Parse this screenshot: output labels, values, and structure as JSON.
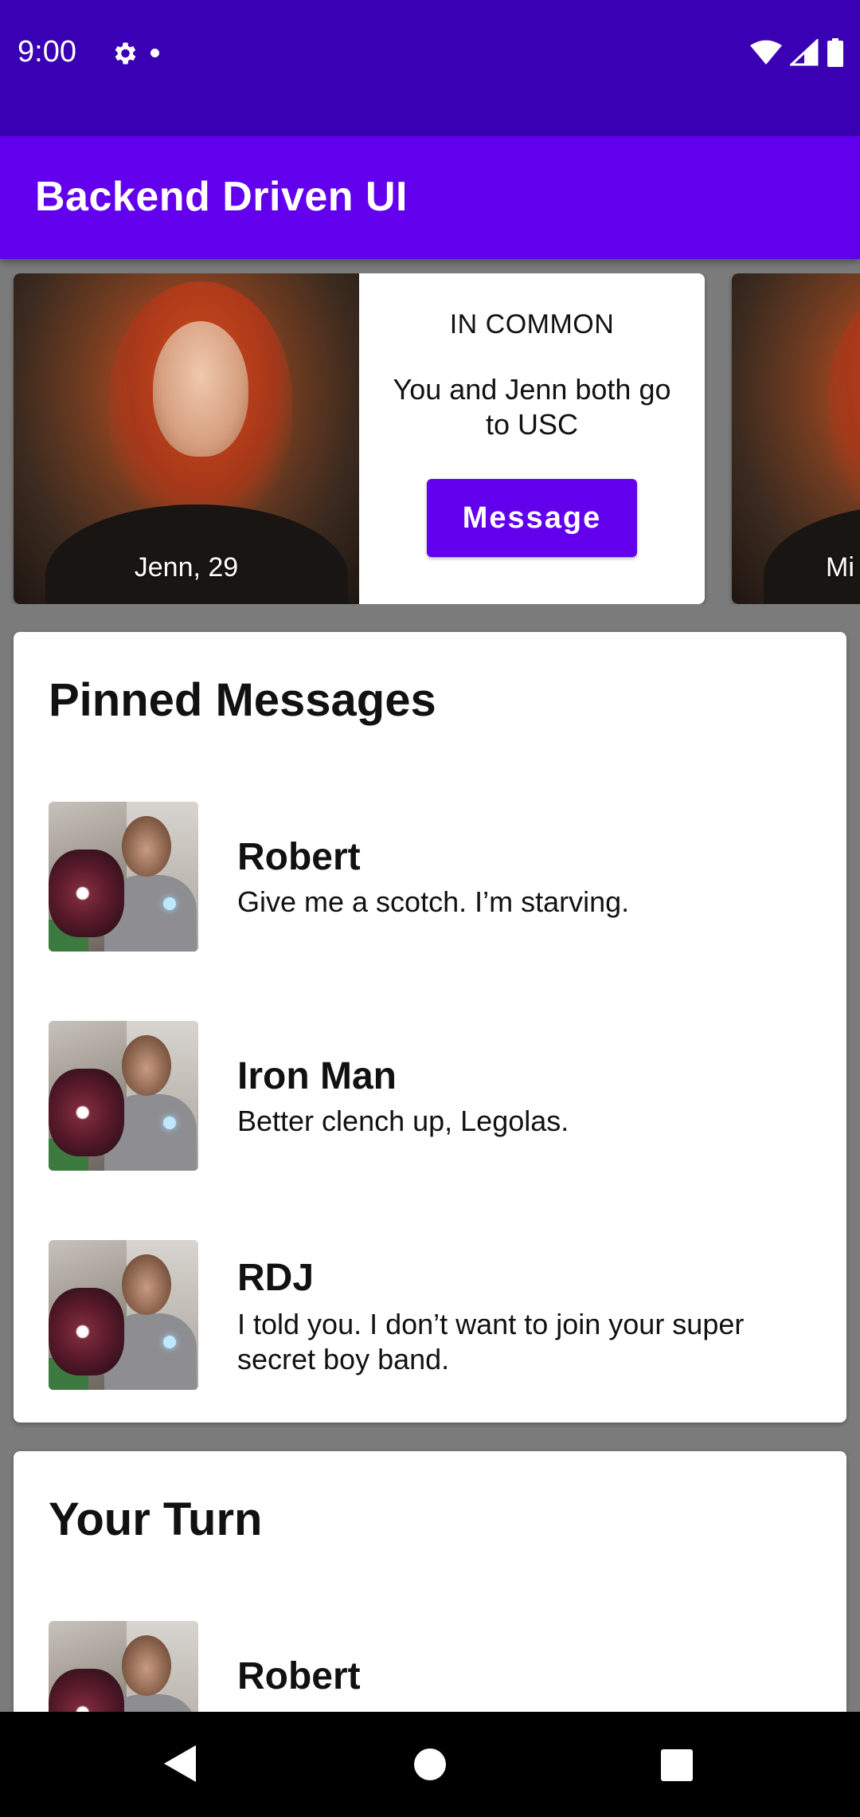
{
  "status_bar": {
    "time": "9:00"
  },
  "app_bar": {
    "title": "Backend Driven UI"
  },
  "carousel": {
    "cards": [
      {
        "name_age": "Jenn, 29",
        "in_common_title": "IN COMMON",
        "in_common_text": "You and Jenn both go to USC",
        "button_label": "Message"
      },
      {
        "name_age_partial": "Mi"
      }
    ]
  },
  "pinned": {
    "title": "Pinned Messages",
    "items": [
      {
        "name": "Robert",
        "text": "Give me a scotch. I’m starving."
      },
      {
        "name": "Iron Man",
        "text": "Better clench up, Legolas."
      },
      {
        "name": "RDJ",
        "text": "I told you. I don’t want to join your super secret boy band."
      }
    ]
  },
  "your_turn": {
    "title": "Your Turn",
    "items": [
      {
        "name": "Robert"
      }
    ]
  },
  "colors": {
    "status_bar": "#3a00b3",
    "app_bar": "#6200ee",
    "button": "#6200ee"
  }
}
